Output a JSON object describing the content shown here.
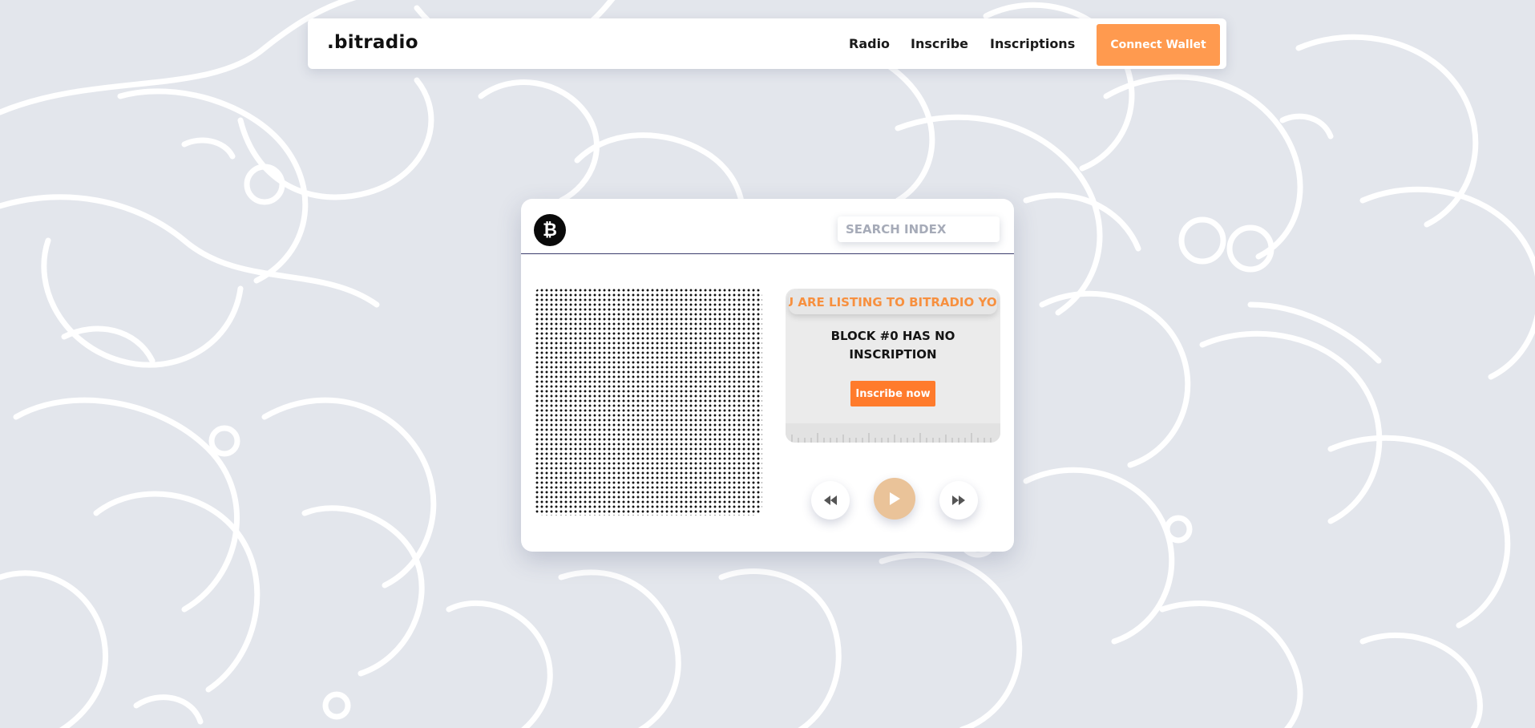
{
  "colors": {
    "background": "#e3e6ec",
    "doodle_stroke": "#ffffff",
    "accent": "#ff9a4f",
    "inscribe_button": "#ff7b2c",
    "ticker_text": "#f7903f",
    "play_button": "#eac399"
  },
  "navbar": {
    "brand": ".bitradio",
    "links": [
      "Radio",
      "Inscribe",
      "Inscriptions"
    ],
    "connect_wallet": "Connect Wallet"
  },
  "radio": {
    "logo_icon": "bitcoin-icon",
    "logo_glyph": "₿",
    "search_placeholder": "SEARCH INDEX",
    "ticker": "U ARE LISTING TO BITRADIO YO",
    "message": "BLOCK #0 HAS NO INSCRIPTION",
    "inscribe_label": "Inscribe now",
    "controls": [
      "rewind-icon",
      "play-icon",
      "fast-forward-icon"
    ]
  }
}
